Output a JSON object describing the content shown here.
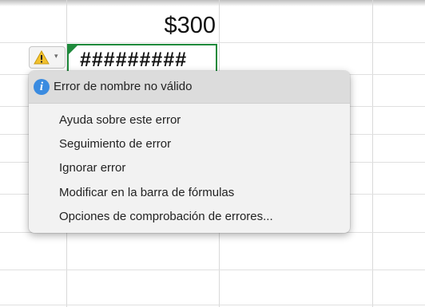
{
  "cell": {
    "value": "$300",
    "error_display": "#########"
  },
  "error_button": {
    "icon": "warning-triangle-icon",
    "caret": "▾"
  },
  "menu": {
    "header": {
      "icon": "info-icon",
      "glyph": "i",
      "title": "Error de nombre no válido"
    },
    "items": [
      {
        "label": "Ayuda sobre este error"
      },
      {
        "label": "Seguimiento de error"
      },
      {
        "label": "Ignorar error"
      },
      {
        "label": "Modificar en la barra de fórmulas"
      },
      {
        "label": "Opciones de comprobación de errores..."
      }
    ]
  },
  "colors": {
    "cell_border": "#1f8a3c",
    "warning": "#f2c12e",
    "info": "#3a8be0",
    "menu_background": "#f2f2f2",
    "menu_header_background": "#dcdcdc",
    "gridline": "#d9d9d9"
  }
}
